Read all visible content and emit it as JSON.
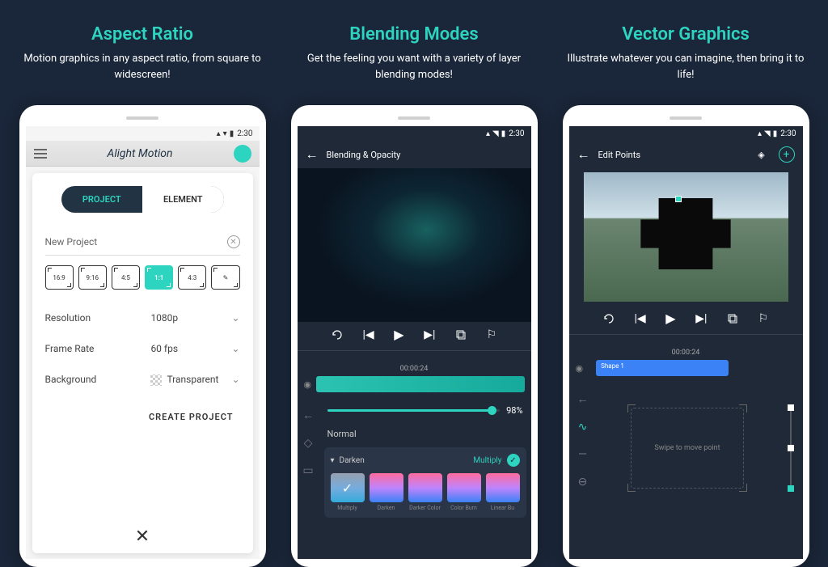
{
  "features": [
    {
      "title": "Aspect Ratio",
      "description": "Motion graphics in any aspect ratio, from square to widescreen!"
    },
    {
      "title": "Blending Modes",
      "description": "Get the feeling you want with a variety of layer blending modes!"
    },
    {
      "title": "Vector Graphics",
      "description": "Illustrate whatever you can imagine, then bring it to life!"
    }
  ],
  "status_time": "2:30",
  "phone1": {
    "app_name": "Alight Motion",
    "tabs": {
      "project": "PROJECT",
      "element": "ELEMENT"
    },
    "project_name": "New Project",
    "ratios": [
      "16:9",
      "9:16",
      "4:5",
      "1:1",
      "4:3"
    ],
    "ratio_pencil": "✎",
    "selected_ratio": "1:1",
    "settings": {
      "resolution_label": "Resolution",
      "resolution_value": "1080p",
      "framerate_label": "Frame Rate",
      "framerate_value": "60 fps",
      "background_label": "Background",
      "background_value": "Transparent"
    },
    "create_button": "CREATE PROJECT"
  },
  "phone2": {
    "header_title": "Blending & Opacity",
    "time_code": "00:00:24",
    "opacity_percent": "98%",
    "blend_normal": "Normal",
    "blend_group": "Darken",
    "blend_selected": "Multiply",
    "thumbs": [
      "Multiply",
      "Darken",
      "Darker Color",
      "Color Burn",
      "Linear Bu"
    ]
  },
  "phone3": {
    "header_title": "Edit Points",
    "time_code": "00:00:24",
    "shape_name": "Shape 1",
    "hint": "Swipe to move point"
  }
}
